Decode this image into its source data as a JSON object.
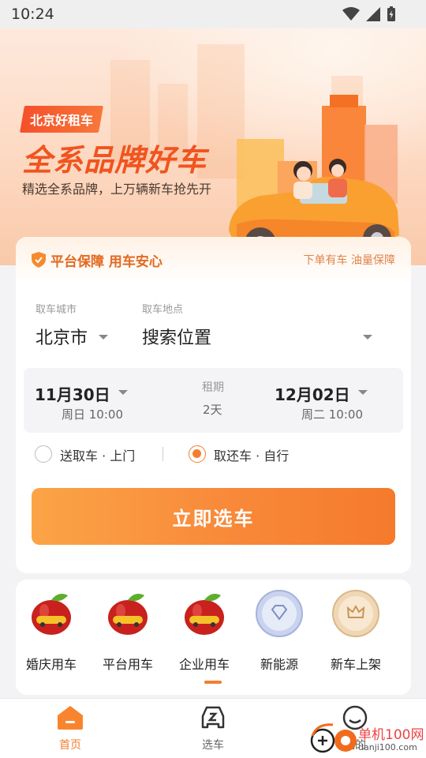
{
  "status_bar": {
    "time": "10:24"
  },
  "banner": {
    "tag": "北京好租车",
    "headline": "全系品牌好车",
    "subline": "精选全系品牌，上万辆新车抢先开"
  },
  "booking": {
    "guarantee_title": "平台保障 用车安心",
    "guarantee_note": "下单有车 油量保障",
    "city_label": "取车城市",
    "city_value": "北京市",
    "location_label": "取车地点",
    "location_value": "搜索位置",
    "pickup_date": "11月30日",
    "pickup_time": "周日 10:00",
    "duration_label": "租期",
    "duration_value": "2天",
    "return_date": "12月02日",
    "return_time": "周二 10:00",
    "option_delivery": "送取车 · 上门",
    "option_self": "取还车 · 自行",
    "selected_option": "self",
    "cta_label": "立即选车"
  },
  "categories": [
    {
      "label": "婚庆用车",
      "icon": "apple-car-icon"
    },
    {
      "label": "平台用车",
      "icon": "apple-car-icon"
    },
    {
      "label": "企业用车",
      "icon": "apple-car-icon"
    },
    {
      "label": "新能源",
      "icon": "diamond-badge-icon"
    },
    {
      "label": "新车上架",
      "icon": "crown-badge-icon"
    }
  ],
  "bottom_nav": {
    "home": "首页",
    "select_car": "选车",
    "mine": "我的"
  },
  "watermark": {
    "line1": "单机100网",
    "line2": "danji100.com"
  },
  "colors": {
    "accent": "#f47d30",
    "brand_red": "#f1541f"
  }
}
